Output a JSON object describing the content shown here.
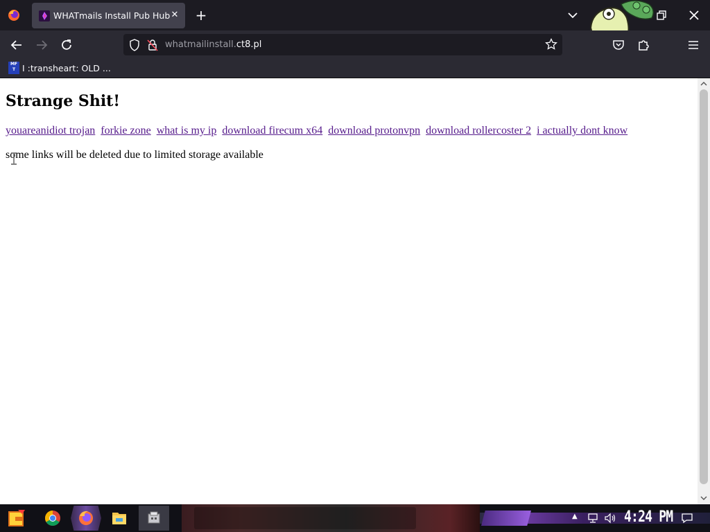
{
  "browser": {
    "tab": {
      "title": "WHATmails Install Pub Hub"
    },
    "url": {
      "prefix": "whatmailinstall.",
      "domain": "ct8.pl"
    },
    "bookmarks": [
      {
        "label": "I :transheart: OLD ..."
      }
    ]
  },
  "page": {
    "heading": "Strange Shit!",
    "links": [
      "youareanidiot trojan",
      "forkie zone",
      "what is my ip",
      "download firecum x64",
      "download protonvpn",
      "download rollercoster 2",
      "i actually dont know"
    ],
    "notice": "some links will be deleted due to limited storage available",
    "link_color": "#551a8b"
  },
  "taskbar": {
    "pinned": [
      "start-icon",
      "chrome-icon",
      "firefox-icon",
      "file-explorer-icon",
      "app-icon"
    ],
    "clock": "4:24 PM"
  },
  "colors": {
    "toolbar": "#2b2a33",
    "tabstrip": "#1c1b22",
    "active_tab": "#42414d"
  }
}
